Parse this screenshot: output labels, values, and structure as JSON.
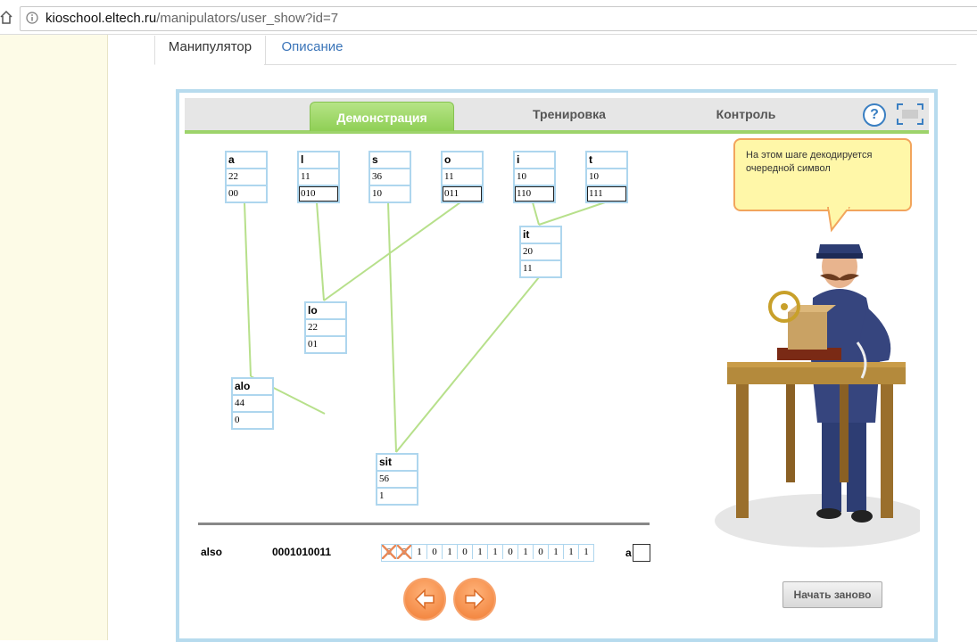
{
  "browser": {
    "url_host": "kioschool.eltech.ru",
    "url_path": "/manipulators/user_show?id=7"
  },
  "page_tabs": [
    {
      "label": "Манипулятор",
      "active": true
    },
    {
      "label": "Описание",
      "active": false
    }
  ],
  "applet": {
    "tabs": [
      {
        "label": "Демонстрация",
        "active": true
      },
      {
        "label": "Тренировка",
        "active": false
      },
      {
        "label": "Контроль",
        "active": false
      }
    ],
    "help_label": "?",
    "speech_bubble": "На этом шаге декодируется очередной символ",
    "nodes": {
      "a": {
        "label": "a",
        "weight": "22",
        "code": "00"
      },
      "l": {
        "label": "l",
        "weight": "11",
        "code": "010"
      },
      "s": {
        "label": "s",
        "weight": "36",
        "code": "10"
      },
      "o": {
        "label": "o",
        "weight": "11",
        "code": "011"
      },
      "i": {
        "label": "i",
        "weight": "10",
        "code": "110"
      },
      "t": {
        "label": "t",
        "weight": "10",
        "code": "111"
      },
      "it": {
        "label": "it",
        "weight": "20",
        "code": "11"
      },
      "lo": {
        "label": "lo",
        "weight": "22",
        "code": "01"
      },
      "alo": {
        "label": "alo",
        "weight": "44",
        "code": "0"
      },
      "sit": {
        "label": "sit",
        "weight": "56",
        "code": "1"
      }
    },
    "word": "also",
    "code": "0001010011",
    "bits": [
      "0",
      "0",
      "1",
      "0",
      "1",
      "0",
      "1",
      "1",
      "0",
      "1",
      "0",
      "1",
      "1",
      "1"
    ],
    "crossed_bits": 2,
    "decoded_label": "a",
    "decoded_value": "",
    "restart_label": "Начать заново",
    "colors": {
      "edge": "#b7e08b",
      "node_border": "#aed6ee",
      "accent_green": "#9dd36b",
      "nav_orange": "#f07c33"
    }
  }
}
